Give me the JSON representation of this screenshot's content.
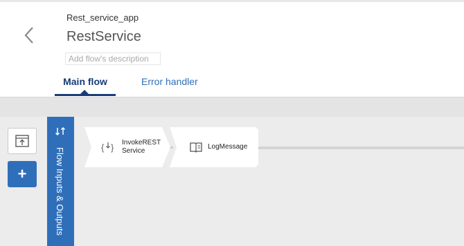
{
  "header": {
    "app_name": "Rest_service_app",
    "flow_title": "RestService",
    "description_placeholder": "Add flow's description"
  },
  "tabs": [
    {
      "label": "Main flow",
      "active": true
    },
    {
      "label": "Error handler",
      "active": false
    }
  ],
  "toolbar": {
    "upload_icon": "upload-window-icon",
    "add_label": "+"
  },
  "io_panel": {
    "label": "Flow Inputs & Outputs",
    "icon": "swap-arrows-icon"
  },
  "flow_nodes": [
    {
      "label": "InvokeRESTService",
      "icon": "rest-invoke-icon"
    },
    {
      "label": "LogMessage",
      "icon": "book-icon"
    }
  ],
  "colors": {
    "accent": "#2f6fba",
    "active_tab": "#1a3b78",
    "canvas": "#ececec"
  }
}
